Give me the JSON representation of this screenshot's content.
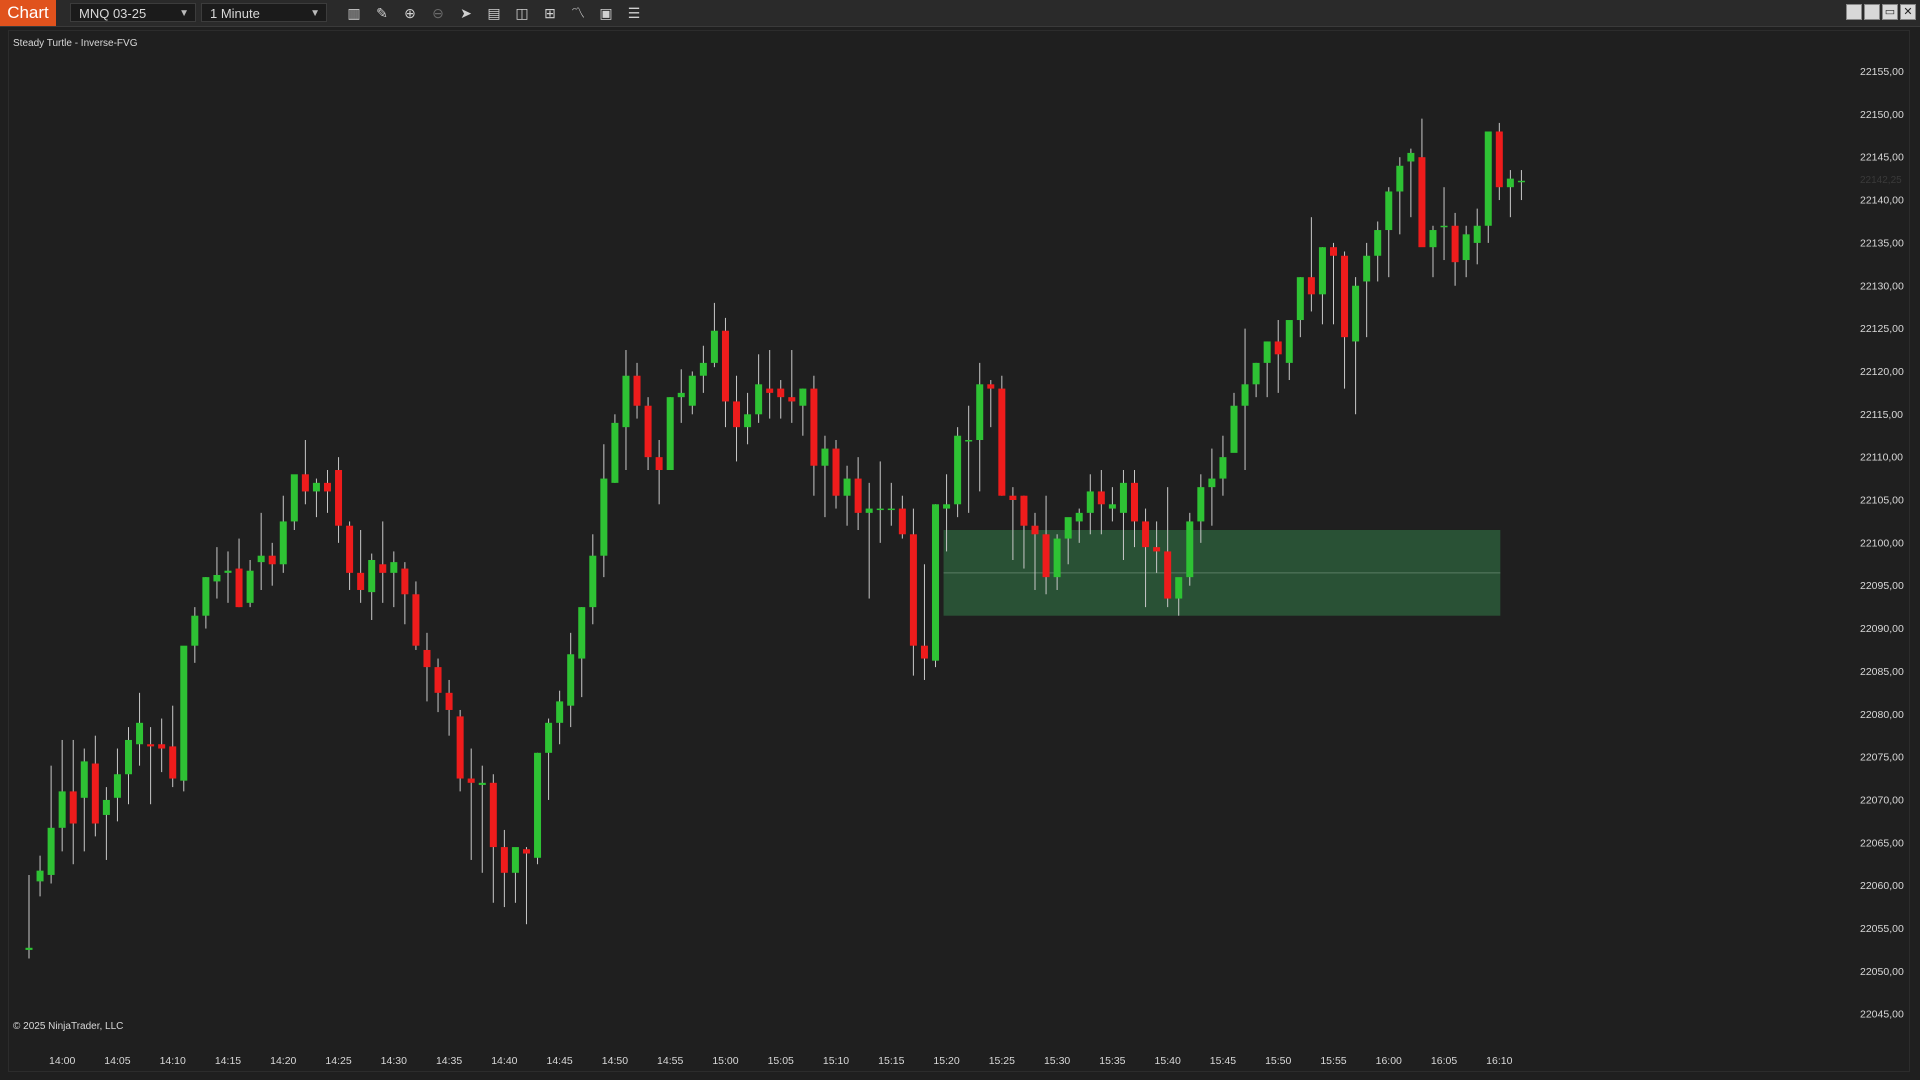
{
  "app": {
    "tab_label": "Chart"
  },
  "toolbar": {
    "instrument": "MNQ 03-25",
    "interval": "1 Minute",
    "icons": [
      "bar-type-icon",
      "draw-tool-icon",
      "zoom-in-icon",
      "zoom-out-icon",
      "pointer-icon",
      "data-box-icon",
      "properties-icon",
      "strategies-icon",
      "indicators-icon",
      "templates-icon",
      "chart-trader-icon"
    ]
  },
  "window_buttons": [
    "tile-icon",
    "maximize-icon",
    "restore-icon",
    "close-icon"
  ],
  "chart": {
    "indicator_label": "Steady Turtle - Inverse-FVG",
    "copyright": "© 2025 NinjaTrader, LLC",
    "current_price_label": "22142,25"
  },
  "colors": {
    "background": "#1f1f1f",
    "up_candle": "#2ec234",
    "down_candle": "#ee1c1c",
    "wick": "#c8c8c8",
    "fvg_zone": "#2b5a3a",
    "tab_accent": "#e0521d"
  },
  "chart_data": {
    "type": "candlestick",
    "x_tick_labels": [
      "14:00",
      "14:05",
      "14:10",
      "14:15",
      "14:20",
      "14:25",
      "14:30",
      "14:35",
      "14:40",
      "14:45",
      "14:50",
      "14:55",
      "15:00",
      "15:05",
      "15:10",
      "15:15",
      "15:20",
      "15:25",
      "15:30",
      "15:35",
      "15:40",
      "15:45",
      "15:50",
      "15:55",
      "16:00",
      "16:05",
      "16:10"
    ],
    "y_tick_labels": [
      "22155,00",
      "22150,00",
      "22145,00",
      "22140,00",
      "22135,00",
      "22130,00",
      "22125,00",
      "22120,00",
      "22115,00",
      "22110,00",
      "22105,00",
      "22100,00",
      "22095,00",
      "22090,00",
      "22085,00",
      "22080,00",
      "22075,00",
      "22070,00",
      "22065,00",
      "22060,00",
      "22055,00",
      "22050,00",
      "22045,00"
    ],
    "ylim": [
      22045,
      22155
    ],
    "start_time": "13:57",
    "bar_interval_minutes": 1,
    "candles": [
      [
        22052.5,
        22061.25,
        22051.5,
        22052.75
      ],
      [
        22060.5,
        22063.5,
        22058.75,
        22061.75
      ],
      [
        22061.25,
        22074,
        22060.25,
        22066.75
      ],
      [
        22066.75,
        22077,
        22064,
        22071
      ],
      [
        22071,
        22077,
        22062.5,
        22067.25
      ],
      [
        22070.25,
        22076,
        22064,
        22074.5
      ],
      [
        22074.25,
        22077.5,
        22065.75,
        22067.25
      ],
      [
        22068.25,
        22071.5,
        22063,
        22070
      ],
      [
        22070.25,
        22076,
        22067.5,
        22073
      ],
      [
        22073,
        22078.5,
        22069.5,
        22077
      ],
      [
        22076.5,
        22082.5,
        22074,
        22079
      ],
      [
        22076.5,
        22078.5,
        22069.5,
        22076.25
      ],
      [
        22076.5,
        22079.5,
        22073.25,
        22076
      ],
      [
        22076.25,
        22081,
        22071.5,
        22072.5
      ],
      [
        22072.25,
        22087.5,
        22071,
        22088
      ],
      [
        22088,
        22092.5,
        22086,
        22091.5
      ],
      [
        22091.5,
        22096,
        22090,
        22096
      ],
      [
        22095.5,
        22099.5,
        22093.5,
        22096.25
      ],
      [
        22096.5,
        22099,
        22093,
        22096.75
      ],
      [
        22097,
        22100.5,
        22092.5,
        22092.5
      ],
      [
        22093,
        22098,
        22092.5,
        22096.75
      ],
      [
        22097.75,
        22103.5,
        22094.5,
        22098.5
      ],
      [
        22098.5,
        22100,
        22095,
        22097.5
      ],
      [
        22097.5,
        22105.5,
        22096.5,
        22102.5
      ],
      [
        22102.5,
        22107,
        22101.5,
        22108
      ],
      [
        22108,
        22112,
        22104.5,
        22106
      ],
      [
        22106,
        22107.5,
        22103,
        22107
      ],
      [
        22107,
        22108.5,
        22103.5,
        22106
      ],
      [
        22108.5,
        22110,
        22100,
        22102
      ],
      [
        22102,
        22102.5,
        22094.5,
        22096.5
      ],
      [
        22096.5,
        22101.5,
        22093,
        22094.5
      ],
      [
        22094.25,
        22098.75,
        22091,
        22098
      ],
      [
        22097.5,
        22102.5,
        22093,
        22096.5
      ],
      [
        22096.5,
        22099,
        22092.5,
        22097.75
      ],
      [
        22097,
        22097.75,
        22090.5,
        22094
      ],
      [
        22094,
        22095.5,
        22087.5,
        22088
      ],
      [
        22087.5,
        22089.5,
        22081.5,
        22085.5
      ],
      [
        22085.5,
        22086.5,
        22080.25,
        22082.5
      ],
      [
        22082.5,
        22084,
        22077.5,
        22080.5
      ],
      [
        22079.75,
        22080.5,
        22071,
        22072.5
      ],
      [
        22072.5,
        22076,
        22063,
        22072
      ],
      [
        22071.75,
        22074,
        22061.5,
        22072
      ],
      [
        22072,
        22073,
        22058,
        22064.5
      ],
      [
        22064.5,
        22066.5,
        22057.5,
        22061.5
      ],
      [
        22061.5,
        22063,
        22058,
        22064.5
      ],
      [
        22064.25,
        22064.5,
        22055.5,
        22063.75
      ],
      [
        22063.25,
        22075.5,
        22062.5,
        22075.5
      ],
      [
        22075.5,
        22079.5,
        22070,
        22079
      ],
      [
        22079,
        22082.75,
        22076.5,
        22081.5
      ],
      [
        22081,
        22089.5,
        22078.5,
        22087
      ],
      [
        22086.5,
        22092.5,
        22082,
        22092.5
      ],
      [
        22092.5,
        22101,
        22090.5,
        22098.5
      ],
      [
        22098.5,
        22111.5,
        22096,
        22107.5
      ],
      [
        22107,
        22115,
        22107,
        22114
      ],
      [
        22113.5,
        22122.5,
        22108.5,
        22119.5
      ],
      [
        22119.5,
        22121,
        22114.5,
        22116
      ],
      [
        22116,
        22117,
        22108.5,
        22110
      ],
      [
        22110,
        22112,
        22104.5,
        22108.5
      ],
      [
        22108.5,
        22117,
        22108.5,
        22117
      ],
      [
        22117,
        22120.25,
        22114,
        22117.5
      ],
      [
        22116,
        22120,
        22115,
        22119.5
      ],
      [
        22119.5,
        22123,
        22117.5,
        22121
      ],
      [
        22121,
        22128,
        22120.5,
        22124.75
      ],
      [
        22124.75,
        22126.25,
        22113.5,
        22116.5
      ],
      [
        22116.5,
        22119.5,
        22109.5,
        22113.5
      ],
      [
        22113.5,
        22117.5,
        22111.5,
        22115
      ],
      [
        22115,
        22122,
        22114,
        22118.5
      ],
      [
        22118,
        22122.5,
        22114.5,
        22117.5
      ],
      [
        22118,
        22119,
        22114.5,
        22117
      ],
      [
        22117,
        22122.5,
        22114,
        22116.5
      ],
      [
        22116,
        22118,
        22112.5,
        22118
      ],
      [
        22118,
        22119.5,
        22105.5,
        22109
      ],
      [
        22109,
        22112.5,
        22103,
        22111
      ],
      [
        22111,
        22112,
        22104,
        22105.5
      ],
      [
        22105.5,
        22109,
        22102,
        22107.5
      ],
      [
        22107.5,
        22110,
        22101.5,
        22103.5
      ],
      [
        22103.5,
        22107,
        22093.5,
        22104
      ],
      [
        22104,
        22109.5,
        22100,
        22104
      ],
      [
        22104,
        22107,
        22102,
        22104
      ],
      [
        22104,
        22105.5,
        22100.5,
        22101
      ],
      [
        22101,
        22104,
        22084.5,
        22088
      ],
      [
        22088,
        22097.5,
        22084,
        22086.5
      ],
      [
        22086.25,
        22104.5,
        22085.5,
        22104.5
      ],
      [
        22104,
        22108,
        22099,
        22104.5
      ],
      [
        22104.5,
        22113.5,
        22103,
        22112.5
      ],
      [
        22112,
        22116,
        22103.5,
        22112
      ],
      [
        22112,
        22121,
        22106,
        22118.5
      ],
      [
        22118.5,
        22119,
        22113.5,
        22118
      ],
      [
        22118,
        22119.5,
        22105.5,
        22105.5
      ],
      [
        22105.5,
        22106.5,
        22098,
        22105
      ],
      [
        22105.5,
        22105.5,
        22097,
        22102
      ],
      [
        22102,
        22103.5,
        22094.5,
        22101
      ],
      [
        22101,
        22105.5,
        22094,
        22096
      ],
      [
        22096,
        22101,
        22094.5,
        22100.5
      ],
      [
        22100.5,
        22102,
        22097.5,
        22103
      ],
      [
        22102.5,
        22104,
        22100,
        22103.5
      ],
      [
        22103.5,
        22108,
        22101,
        22106
      ],
      [
        22106,
        22108.5,
        22101,
        22104.5
      ],
      [
        22104,
        22106.5,
        22102.5,
        22104.5
      ],
      [
        22103.5,
        22108.5,
        22098,
        22107
      ],
      [
        22107,
        22108.5,
        22099.5,
        22102.5
      ],
      [
        22102.5,
        22104,
        22092.5,
        22099.5
      ],
      [
        22099.5,
        22102.5,
        22096.5,
        22099
      ],
      [
        22099,
        22106.5,
        22092.5,
        22093.5
      ],
      [
        22093.5,
        22095,
        22091.5,
        22096
      ],
      [
        22096,
        22103.5,
        22095,
        22102.5
      ],
      [
        22102.5,
        22108,
        22100,
        22106.5
      ],
      [
        22106.5,
        22111,
        22102,
        22107.5
      ],
      [
        22107.5,
        22112.5,
        22105.5,
        22110
      ],
      [
        22110.5,
        22117.5,
        22112,
        22116
      ],
      [
        22116,
        22125,
        22108.5,
        22118.5
      ],
      [
        22118.5,
        22121,
        22117,
        22121
      ],
      [
        22121,
        22123.5,
        22117,
        22123.5
      ],
      [
        22123.5,
        22126,
        22117.5,
        22122
      ],
      [
        22121,
        22125,
        22119,
        22126
      ],
      [
        22126,
        22131,
        22124,
        22131
      ],
      [
        22131,
        22138,
        22127,
        22129
      ],
      [
        22129,
        22134.5,
        22125.5,
        22134.5
      ],
      [
        22134.5,
        22135,
        22125.5,
        22133.5
      ],
      [
        22133.5,
        22134,
        22118,
        22124
      ],
      [
        22123.5,
        22131,
        22115,
        22130
      ],
      [
        22130.5,
        22135,
        22124,
        22133.5
      ],
      [
        22133.5,
        22137.5,
        22130.5,
        22136.5
      ],
      [
        22136.5,
        22141.5,
        22131,
        22141
      ],
      [
        22141,
        22145,
        22136,
        22144
      ],
      [
        22144.5,
        22146,
        22138,
        22145.5
      ],
      [
        22145,
        22149.5,
        22135,
        22134.5
      ],
      [
        22134.5,
        22137,
        22131,
        22136.5
      ],
      [
        22137,
        22141.5,
        22133,
        22137
      ],
      [
        22137,
        22138.5,
        22130,
        22132.75
      ],
      [
        22133,
        22137,
        22131,
        22136
      ],
      [
        22135,
        22139,
        22132.5,
        22137
      ],
      [
        22137,
        22146,
        22135,
        22148
      ],
      [
        22148,
        22149,
        22140,
        22141.5
      ],
      [
        22141.5,
        22143.5,
        22138,
        22142.5
      ],
      [
        22142.25,
        22143.5,
        22140,
        22142.25
      ]
    ],
    "fvg_zone": {
      "top": 22101.5,
      "bottom": 22091.5,
      "midline": 22096.5,
      "start_time": "15:20",
      "end_time": "16:10"
    }
  }
}
